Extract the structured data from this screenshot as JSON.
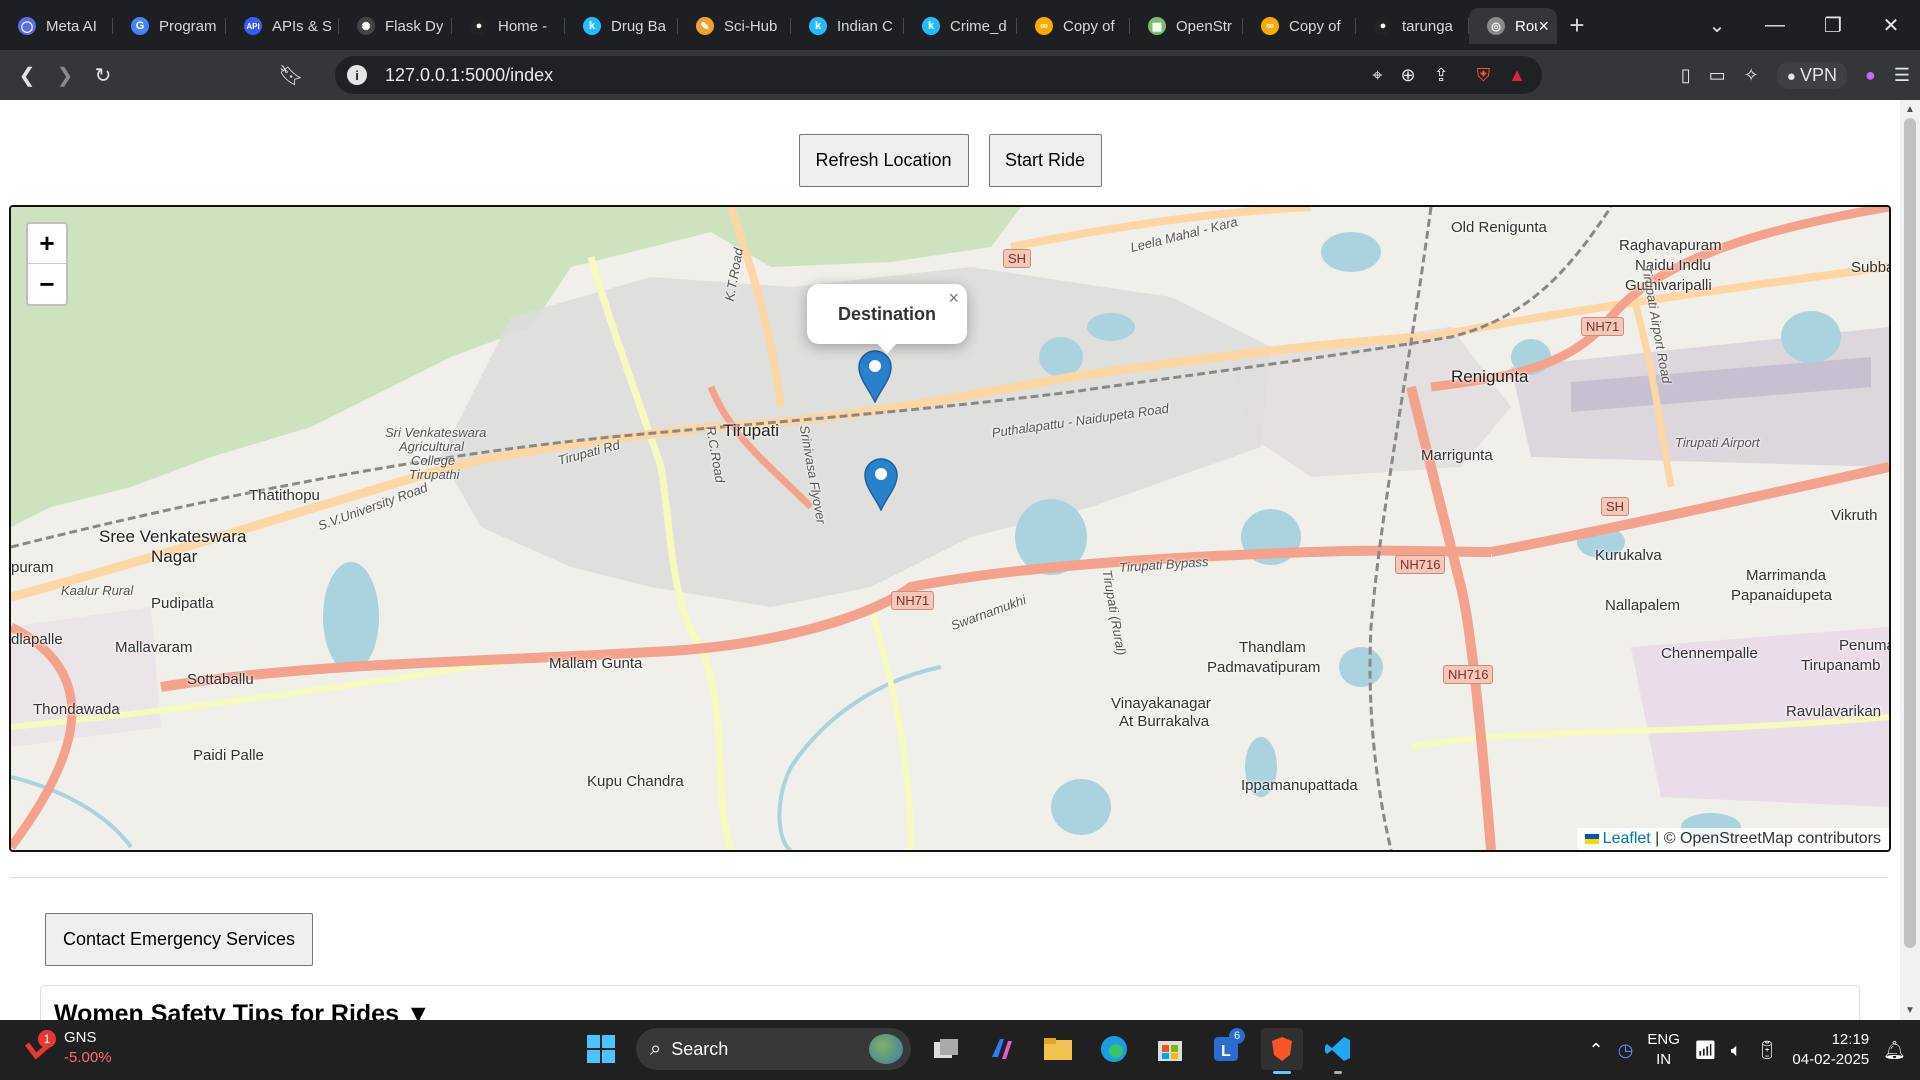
{
  "browser": {
    "tabs": [
      {
        "label": "Meta AI",
        "icon": "meta-ai-icon",
        "color": "#5b6cf0"
      },
      {
        "label": "Program",
        "icon": "google-icon",
        "color": "#4285f4"
      },
      {
        "label": "APIs & S",
        "icon": "api-icon",
        "color": "#3d5afe"
      },
      {
        "label": "Flask Dy",
        "icon": "chatgpt-icon",
        "color": "#444"
      },
      {
        "label": "Home -",
        "icon": "github-icon",
        "color": "#222"
      },
      {
        "label": "Drug Ba",
        "icon": "kaggle-icon",
        "color": "#20beff"
      },
      {
        "label": "Sci-Hub",
        "icon": "scihub-icon",
        "color": "#f0a030"
      },
      {
        "label": "Indian C",
        "icon": "kaggle-icon",
        "color": "#20beff"
      },
      {
        "label": "Crime_d",
        "icon": "kaggle-icon",
        "color": "#20beff"
      },
      {
        "label": "Copy of",
        "icon": "colab-icon",
        "color": "#f9ab00"
      },
      {
        "label": "OpenStr",
        "icon": "openstreetmap-icon",
        "color": "#7ebc6f"
      },
      {
        "label": "Copy of",
        "icon": "colab-icon",
        "color": "#f9ab00"
      },
      {
        "label": "tarunga",
        "icon": "github-icon",
        "color": "#222"
      }
    ],
    "active_tab": {
      "label": "Rou",
      "icon": "globe-icon"
    },
    "url": "127.0.0.1:5000/index",
    "vpn_label": "VPN"
  },
  "page": {
    "refresh_label": "Refresh Location",
    "start_label": "Start Ride",
    "emergency_label": "Contact Emergency Services",
    "tips_title": "Women Safety Tips for Rides ▼"
  },
  "map": {
    "zoom_in": "+",
    "zoom_out": "−",
    "popup_text": "Destination",
    "popup_close": "×",
    "attribution_leaflet": "Leaflet",
    "attribution_rest": " | © OpenStreetMap contributors",
    "labels": {
      "tirupati": "Tirupati",
      "renigunta": "Renigunta",
      "old_renigunta": "Old Renigunta",
      "raghavapuram": "Raghavapuram",
      "naidu_indlu": "Naidu Indlu",
      "guthivaripalli": "Guthivaripalli",
      "marrigunta": "Marrigunta",
      "tirupati_airport": "Tirupati Airport",
      "vikruthamala": "Vikruth",
      "kurukalva": "Kurukalva",
      "marrimanda": "Marrimanda",
      "papanaidupeta": "Papanaidupeta",
      "nallapalem": "Nallapalem",
      "chennempalle": "Chennempalle",
      "penuma": "Penuma",
      "tirupanamb": "Tirupanamb",
      "ravulavarikan": "Ravulavarikan",
      "thatithopu": "Thatithopu",
      "sree_venkateswara_nagar_1": "Sree Venkateswara",
      "sree_venkateswara_nagar_2": "Nagar",
      "pudipatla": "Pudipatla",
      "mallavaram": "Mallavaram",
      "sottaballu": "Sottaballu",
      "thondawada": "Thondawada",
      "paidi_palle": "Paidi Palle",
      "kupu_chandra": "Kupu Chandra",
      "mallam_gunta": "Mallam Gunta",
      "thandlam": "Thandlam",
      "padmavatipuram": "Padmavatipuram",
      "vinayakanagar": "Vinayakanagar",
      "at_burrakalva": "At Burrakalva",
      "ippamanupattada": "Ippamanupattada",
      "agri_college_1": "Sri Venkateswara",
      "agri_college_2": "Agricultural",
      "agri_college_3": "College",
      "agri_college_4": "Tirupathi",
      "tirupati_bypass": "Tirupati Bypass",
      "puram": "puram",
      "dlapalle": "dlapalle",
      "subba": "Subba",
      "kaalur_rural": "Kaalur Rural",
      "swarnamukhi": "Swarnamukhi",
      "sv_university_road": "S.V.University Road",
      "tirupati_rd": "Tirupati Rd",
      "kt_road": "K.T.Road",
      "rc_road": "R.C.Road",
      "srinivasa_flyover": "Srinivasa Flyover",
      "puthalapattu_road": "Puthalapattu - Naidupeta Road",
      "leela_mahal": "Leela Mahal - Kara",
      "tirupati_airport_road": "Tirupati Airport Road",
      "tirupati_rural": "Tirupati (Rural)",
      "nh71_a": "NH71",
      "nh71_b": "NH71",
      "nh716_a": "NH716",
      "nh716_b": "NH716",
      "sh_a": "SH",
      "sh_b": "SH"
    }
  },
  "taskbar": {
    "ticker_name": "GNS",
    "ticker_change": "-5.00%",
    "notif_count": "1",
    "search_label": "Search",
    "lang_1": "ENG",
    "lang_2": "IN",
    "time": "12:19",
    "date": "04-02-2025",
    "l_badge": "6"
  }
}
